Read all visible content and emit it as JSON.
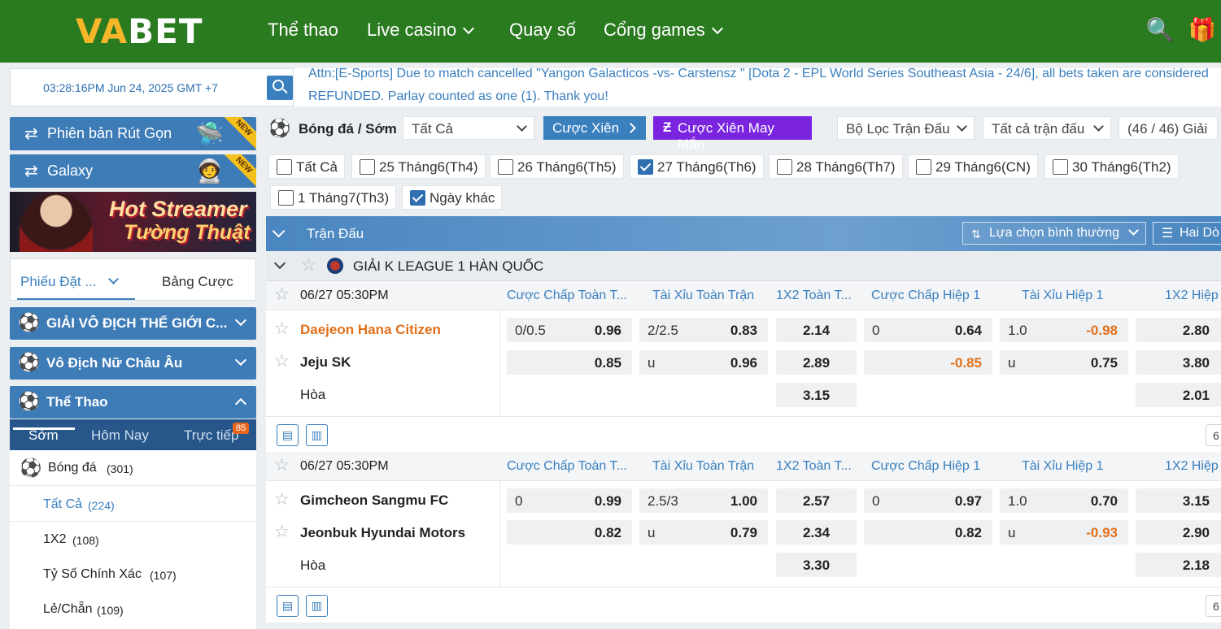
{
  "header": {
    "logo_a": "VA",
    "logo_b": "BET",
    "nav": [
      "Thể thao",
      "Live casino",
      "Quay số",
      "Cổng games"
    ]
  },
  "topbar": {
    "clock": "03:28:16PM Jun 24, 2025 GMT +7",
    "ticker_line1": "Attn:[E-Sports] Due to match cancelled \"Yangon Galacticos -vs- Carstensz \" [Dota 2 - EPL World Series Southeast Asia - 24/6], all bets taken are considered",
    "ticker_line2": "REFUNDED. Parlay counted as one (1). Thank you!"
  },
  "sidebar": {
    "short_version": "Phiên bản Rút Gọn",
    "galaxy": "Galaxy",
    "new_badge": "NEW",
    "banner_line1": "Hot Streamer",
    "banner_line2": "Tường Thuật",
    "slip_tab": "Phiếu Đặt ...",
    "bet_table_tab": "Bảng Cược",
    "categories": [
      "GIẢI VÔ ĐỊCH THẾ GIỚI C...",
      "Vô Địch Nữ Châu Âu",
      "Thể Thao"
    ],
    "tabs": [
      "Sớm",
      "Hôm Nay",
      "Trực tiếp"
    ],
    "live_count": "85",
    "sport": {
      "name": "Bóng đá",
      "count": "(301)"
    },
    "sub_items": [
      {
        "name": "Tất Cả",
        "count": "(224)"
      },
      {
        "name": "1X2",
        "count": "(108)"
      },
      {
        "name": "Tỷ Số Chính Xác",
        "count": "(107)"
      },
      {
        "name": "Lẻ/Chẵn",
        "count": "(109)"
      }
    ]
  },
  "filters": {
    "title": "Bóng đá / Sớm",
    "market_select": "Tất Cả",
    "parlay": "Cược Xiên",
    "lucky_parlay": "Cược Xiên May Mắn",
    "match_filter": "Bộ Lọc Trận Đấu",
    "all_matches": "Tất cả trận đấu",
    "league_count": "(46 / 46) Giải",
    "dates": [
      {
        "label": "Tất Cả",
        "checked": false
      },
      {
        "label": "25 Tháng6(Th4)",
        "checked": false
      },
      {
        "label": "26 Tháng6(Th5)",
        "checked": false
      },
      {
        "label": "27 Tháng6(Th6)",
        "checked": true
      },
      {
        "label": "28 Tháng6(Th7)",
        "checked": false
      },
      {
        "label": "29 Tháng6(CN)",
        "checked": false
      },
      {
        "label": "30 Tháng6(Th2)",
        "checked": false
      },
      {
        "label": "1 Tháng7(Th3)",
        "checked": false
      },
      {
        "label": "Ngày khác",
        "checked": true
      }
    ]
  },
  "table": {
    "header": "Trận Đấu",
    "sort": "Lựa chọn bình thường",
    "lines": "Hai Dò",
    "league": "GIẢI K LEAGUE 1 HÀN QUỐC",
    "columns": [
      "Cược Chấp Toàn T...",
      "Tài Xỉu Toàn Trận",
      "1X2 Toàn T...",
      "Cược Chấp Hiệp 1",
      "Tài Xỉu Hiệp 1",
      "1X2 Hiệp"
    ],
    "more": "6",
    "matches": [
      {
        "time": "06/27 05:30PM",
        "home": "Daejeon Hana Citizen",
        "away": "Jeju SK",
        "draw": "Hòa",
        "hdp_line": "0/0.5",
        "hdp_home": "0.96",
        "hdp_away": "0.85",
        "ou_line": "2/2.5",
        "ou_over": "0.83",
        "ou_u": "u",
        "ou_under": "0.96",
        "x12": [
          "2.14",
          "2.89",
          "3.15"
        ],
        "h1_hdp_line": "0",
        "h1_hdp_home": "0.64",
        "h1_hdp_away": "-0.85",
        "h1_ou_line": "1.0",
        "h1_ou_over": "-0.98",
        "h1_ou_u": "u",
        "h1_ou_under": "0.75",
        "h1_x12": [
          "2.80",
          "3.80",
          "2.01"
        ]
      },
      {
        "time": "06/27 05:30PM",
        "home": "Gimcheon Sangmu FC",
        "away": "Jeonbuk Hyundai Motors",
        "draw": "Hòa",
        "hdp_line": "0",
        "hdp_home": "0.99",
        "hdp_away": "0.82",
        "ou_line": "2.5/3",
        "ou_over": "1.00",
        "ou_u": "u",
        "ou_under": "0.79",
        "x12": [
          "2.57",
          "2.34",
          "3.30"
        ],
        "h1_hdp_line": "0",
        "h1_hdp_home": "0.97",
        "h1_hdp_away": "0.82",
        "h1_ou_line": "1.0",
        "h1_ou_over": "0.70",
        "h1_ou_u": "u",
        "h1_ou_under": "-0.93",
        "h1_x12": [
          "3.15",
          "2.90",
          "2.18"
        ]
      }
    ]
  }
}
